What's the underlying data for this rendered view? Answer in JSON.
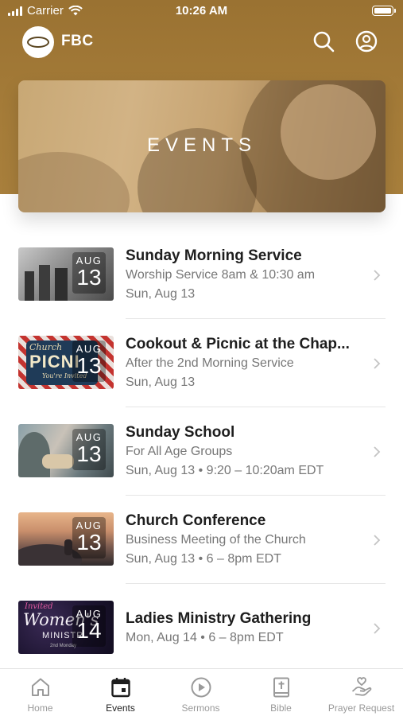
{
  "status_bar": {
    "carrier": "Carrier",
    "time": "10:26 AM"
  },
  "app_bar": {
    "title": "FBC",
    "logo": "church-logo",
    "icons": [
      "search-icon",
      "account-icon"
    ]
  },
  "banner": {
    "title": "EVENTS"
  },
  "events": [
    {
      "title": "Sunday Morning Service",
      "subtitle": "Worship Service 8am & 10:30 am",
      "date": "Sun, Aug 13",
      "badge_month": "AUG",
      "badge_day": "13"
    },
    {
      "title": "Cookout & Picnic at the Chap...",
      "subtitle": "After the 2nd Morning Service",
      "date": "Sun, Aug 13",
      "badge_month": "AUG",
      "badge_day": "13",
      "thumb_text": {
        "line1": "Church",
        "line2": "PICNI",
        "line3": "You're Invited"
      }
    },
    {
      "title": "Sunday School",
      "subtitle": "For All Age Groups",
      "date": "Sun, Aug 13 • 9:20 – 10:20am EDT",
      "badge_month": "AUG",
      "badge_day": "13"
    },
    {
      "title": "Church Conference",
      "subtitle": "Business Meeting of the Church",
      "date": "Sun, Aug 13 • 6 – 8pm EDT",
      "badge_month": "AUG",
      "badge_day": "13"
    },
    {
      "title": "Ladies Ministry Gathering",
      "subtitle": "",
      "date": "Mon, Aug 14 • 6 – 8pm EDT",
      "badge_month": "AUG",
      "badge_day": "14",
      "thumb_text": {
        "line1": "Invited",
        "line2": "Women's",
        "line3": "MINISTR",
        "line4": "2nd Monday"
      }
    }
  ],
  "tabs": [
    {
      "label": "Home",
      "icon": "home-icon",
      "active": false
    },
    {
      "label": "Events",
      "icon": "calendar-icon",
      "active": true
    },
    {
      "label": "Sermons",
      "icon": "play-icon",
      "active": false
    },
    {
      "label": "Bible",
      "icon": "bible-icon",
      "active": false
    },
    {
      "label": "Prayer Request",
      "icon": "prayer-hand-icon",
      "active": false
    }
  ],
  "colors": {
    "header": "#a57c39",
    "text_primary": "#1e1e1e",
    "text_secondary": "#777777",
    "tab_active": "#222222",
    "tab_inactive": "#999999"
  }
}
